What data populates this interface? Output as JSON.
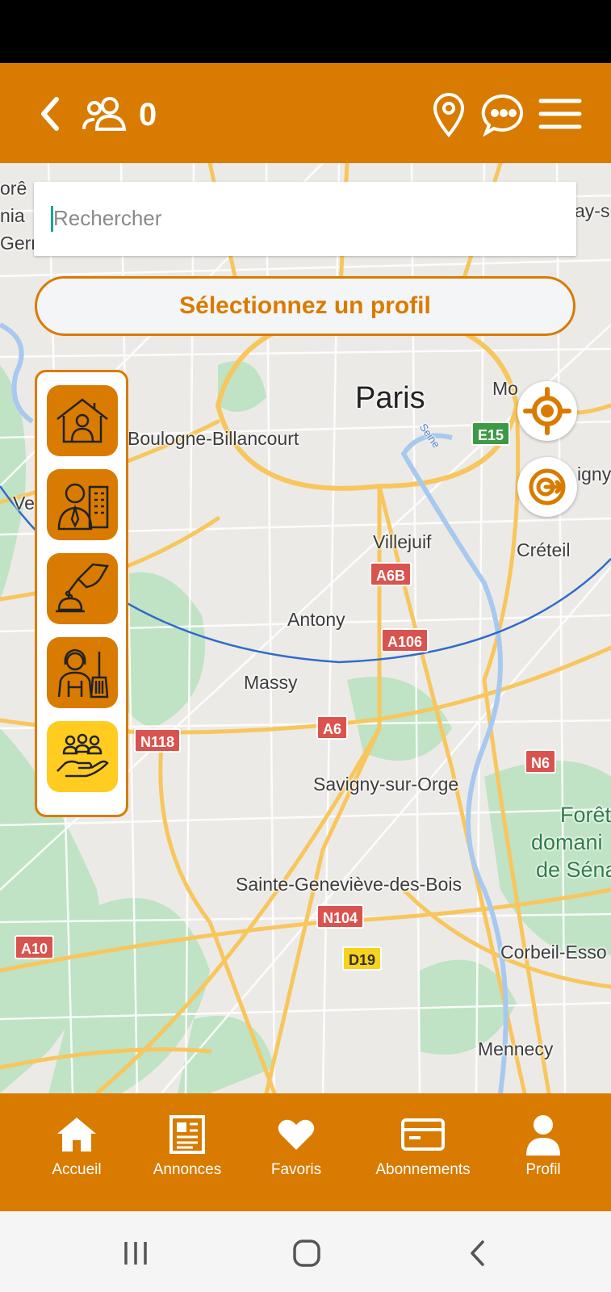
{
  "header": {
    "back_icon": "chevron-left-icon",
    "users_icon": "users-icon",
    "users_count": "0",
    "location_icon": "map-pin-icon",
    "chat_icon": "chat-bubble-icon",
    "menu_icon": "hamburger-menu-icon"
  },
  "search": {
    "placeholder": "Rechercher",
    "value": ""
  },
  "profile_selector": {
    "label": "Sélectionnez un profil"
  },
  "categories": [
    {
      "icon": "house-person-icon",
      "active": false
    },
    {
      "icon": "businessman-icon",
      "active": false
    },
    {
      "icon": "hand-bell-service-icon",
      "active": false
    },
    {
      "icon": "cleaner-icon",
      "active": false
    },
    {
      "icon": "community-hand-icon",
      "active": true
    }
  ],
  "map": {
    "places": {
      "paris": "Paris",
      "boulogne": "Boulogne-Billancourt",
      "villejuif": "Villejuif",
      "creteil": "Créteil",
      "antony": "Antony",
      "massy": "Massy",
      "savigny": "Savigny-sur-Orge",
      "sainte_genevieve": "Sainte-Geneviève-des-Bois",
      "corbeil": "Corbeil-Esso",
      "mennecy": "Mennecy",
      "foret": "Forêt",
      "domaniale": "domani",
      "senart": "de Séna",
      "seine": "Seine",
      "mo": "Mo",
      "ve": "Ve",
      "igny": "igny",
      "ay_s": "ay-s",
      "left_top_1": "orê",
      "left_top_2": "nia",
      "left_top_3": "Germain"
    },
    "roads": [
      "E15",
      "A6B",
      "A106",
      "A6",
      "N118",
      "N6",
      "N104",
      "A10",
      "D19"
    ],
    "colors": {
      "land": "#eceae6",
      "park": "#bfe3c4",
      "major_road": "#f8c65e",
      "radius_circle": "#2f6cc9"
    }
  },
  "fabs": {
    "locate_icon": "crosshair-target-icon",
    "route_icon": "navigation-arrow-icon"
  },
  "bottom_nav": {
    "items": [
      {
        "label": "Accueil",
        "icon": "home-icon"
      },
      {
        "label": "Annonces",
        "icon": "newspaper-icon"
      },
      {
        "label": "Favoris",
        "icon": "heart-icon"
      },
      {
        "label": "Abonnements",
        "icon": "credit-card-icon"
      },
      {
        "label": "Profil",
        "icon": "person-icon"
      }
    ]
  },
  "system_nav": {
    "recent_icon": "recent-apps-icon",
    "home_icon": "system-home-icon",
    "back_icon": "system-back-icon"
  },
  "colors": {
    "brand": "#d97b00",
    "active_category": "#ffcc1f"
  }
}
